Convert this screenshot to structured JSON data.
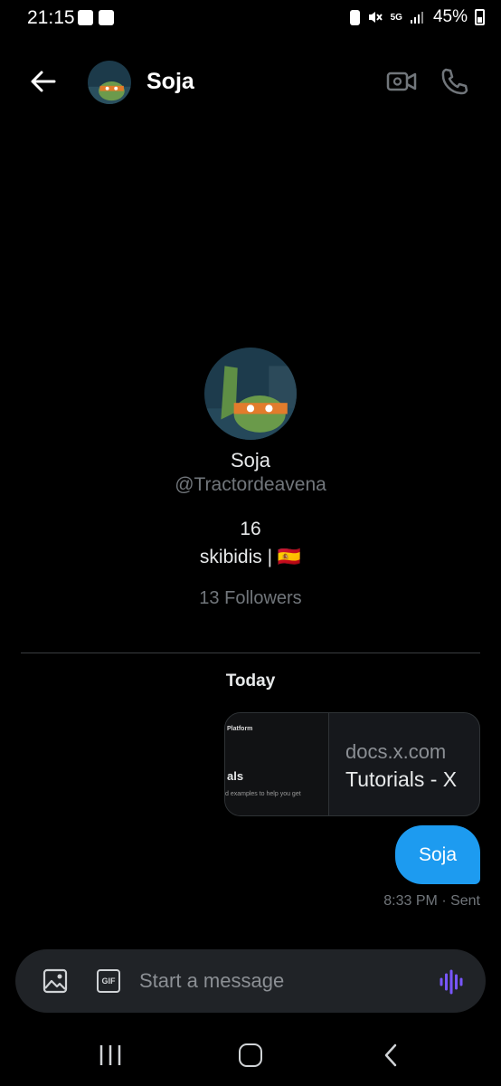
{
  "status_bar": {
    "time": "21:15",
    "network": "5G",
    "battery": "45%"
  },
  "header": {
    "name": "Soja"
  },
  "profile": {
    "name": "Soja",
    "handle": "@Tractordeavena",
    "bio_line1": "16",
    "bio_line2": "skibidis | 🇪🇸",
    "followers": "13 Followers"
  },
  "conversation": {
    "date_label": "Today",
    "link_card": {
      "thumb_header": "Platform",
      "thumb_title": "als",
      "thumb_caption": "d examples to help you get",
      "domain": "docs.x.com",
      "title": "Tutorials - X"
    },
    "message": {
      "text": "Soja",
      "meta": "8:33 PM · Sent"
    }
  },
  "composer": {
    "placeholder": "Start a message",
    "gif_label": "GIF"
  },
  "colors": {
    "accent": "#1d9bf0",
    "voice": "#7856ff",
    "background": "#000000"
  }
}
